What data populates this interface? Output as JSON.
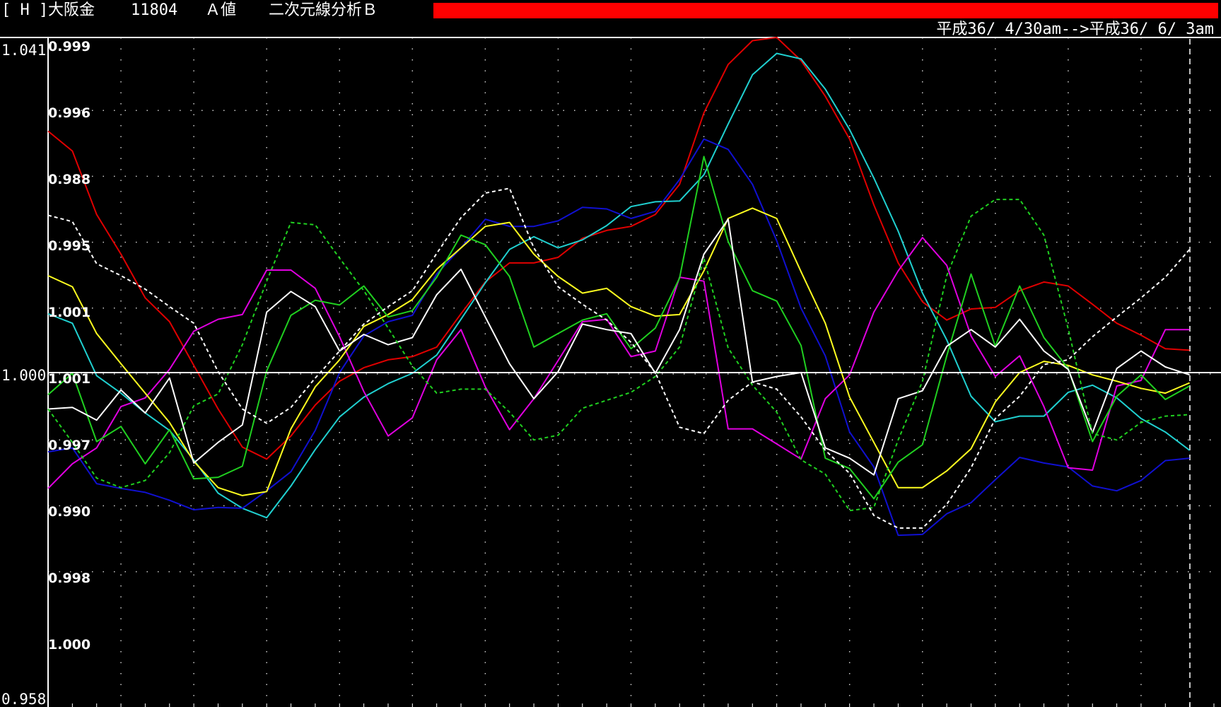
{
  "header": {
    "bracket": "[ H ]",
    "instrument": "大阪金",
    "code": "11804",
    "mode": "Ａ値",
    "analysis": "二次元線分析Ｂ",
    "date_range": "平成36/ 4/30am-->平成36/ 6/ 3am",
    "highlight_color": "#ff0000"
  },
  "chart_data": {
    "type": "line",
    "title": "",
    "background": "#000000",
    "grid": "dotted",
    "xlim": [
      0,
      48
    ],
    "ylim": [
      0.958,
      1.041
    ],
    "outer_axis_labels": [
      "1.041",
      "1.000",
      "0.958"
    ],
    "inner_labels": [
      "0.999",
      "0.996",
      "0.988",
      "0.995",
      "1.001",
      "1.001",
      "0.997",
      "0.990",
      "0.998",
      "1.000"
    ],
    "baseline": 1.0,
    "series": [
      {
        "color": "#e00000",
        "style": "solid",
        "values": [
          1.0292,
          1.0267,
          1.0187,
          1.0137,
          1.0082,
          1.0052,
          0.9997,
          0.9942,
          0.9894,
          0.9879,
          0.9908,
          0.9947,
          0.9977,
          0.9994,
          1.0004,
          1.0008,
          1.002,
          1.0062,
          1.0102,
          1.0126,
          1.0126,
          1.0133,
          1.0157,
          1.0167,
          1.0172,
          1.0187,
          1.0225,
          1.0315,
          1.0376,
          1.0406,
          1.041,
          1.0381,
          1.0336,
          1.0282,
          1.0199,
          1.0126,
          1.0077,
          1.0054,
          1.0068,
          1.007,
          1.0091,
          1.0102,
          1.0097,
          1.0074,
          1.005,
          1.0035,
          1.0018,
          1.0016
        ]
      },
      {
        "color": "#20d0d0",
        "style": "solid",
        "values": [
          1.0062,
          1.005,
          0.9984,
          0.9962,
          0.9937,
          0.9915,
          0.9878,
          0.9836,
          0.9817,
          0.9805,
          0.9845,
          0.9891,
          0.9932,
          0.9957,
          0.9974,
          0.9987,
          1.001,
          1.0055,
          1.0101,
          1.0143,
          1.0159,
          1.0145,
          1.0155,
          1.0173,
          1.0197,
          1.0203,
          1.0204,
          1.0237,
          1.0301,
          1.0363,
          1.039,
          1.0383,
          1.0345,
          1.0294,
          1.0233,
          1.0166,
          1.0088,
          1.0029,
          0.9958,
          0.9926,
          0.9933,
          0.9933,
          0.9963,
          0.9972,
          0.9956,
          0.993,
          0.9913,
          0.989
        ]
      },
      {
        "color": "#1010d0",
        "style": "solid",
        "values": [
          0.9888,
          0.9893,
          0.9848,
          0.9842,
          0.9837,
          0.9827,
          0.9815,
          0.9818,
          0.9817,
          0.9839,
          0.9863,
          0.9915,
          0.9988,
          1.0034,
          1.0052,
          1.006,
          1.0112,
          1.0145,
          1.0181,
          1.0172,
          1.0172,
          1.0179,
          1.0196,
          1.0194,
          1.0182,
          1.0191,
          1.0231,
          1.0282,
          1.0269,
          1.0225,
          1.0154,
          1.0069,
          1.0009,
          0.9913,
          0.9869,
          0.9783,
          0.9784,
          0.981,
          0.9824,
          0.9853,
          0.9881,
          0.9874,
          0.9869,
          0.9845,
          0.9839,
          0.9852,
          0.9877,
          0.988
        ]
      },
      {
        "color": "#e000e0",
        "style": "solid",
        "values": [
          0.9842,
          0.9873,
          0.9893,
          0.9945,
          0.9956,
          0.9992,
          1.004,
          1.0055,
          1.0061,
          1.0117,
          1.0117,
          1.0094,
          1.0033,
          0.9964,
          0.9908,
          0.9931,
          1.0004,
          1.0042,
          0.997,
          0.9916,
          0.9955,
          1.0003,
          1.0052,
          1.0055,
          1.0008,
          1.0015,
          1.0108,
          1.0103,
          0.9917,
          0.9917,
          0.9898,
          0.9879,
          0.9955,
          0.9985,
          1.0064,
          1.0116,
          1.0158,
          1.0123,
          1.0034,
          0.9983,
          1.0009,
          0.9945,
          0.9868,
          0.9865,
          0.9971,
          0.9978,
          1.0042,
          1.0042
        ]
      },
      {
        "color": "#ffff20",
        "style": "solid",
        "values": [
          1.011,
          1.0096,
          1.0037,
          0.9999,
          0.9962,
          0.9925,
          0.9876,
          0.9843,
          0.9833,
          0.9838,
          0.9917,
          0.997,
          1.0004,
          1.0046,
          1.0061,
          1.008,
          1.0118,
          1.0145,
          1.0172,
          1.0177,
          1.0137,
          1.0109,
          1.0088,
          1.0094,
          1.0071,
          1.0059,
          1.0061,
          1.0116,
          1.0182,
          1.0195,
          1.0182,
          1.0115,
          1.005,
          0.9957,
          0.99,
          0.9843,
          0.9843,
          0.9864,
          0.9892,
          0.9951,
          0.9988,
          1.0002,
          0.9997,
          0.9985,
          0.9977,
          0.9968,
          0.9962,
          0.9975
        ]
      },
      {
        "color": "#20d020",
        "style": "solid",
        "values": [
          0.996,
          0.9987,
          0.9901,
          0.992,
          0.9873,
          0.9916,
          0.9854,
          0.9856,
          0.987,
          0.999,
          1.006,
          1.0079,
          1.0073,
          1.0097,
          1.0058,
          1.0066,
          1.0108,
          1.0161,
          1.0149,
          1.0109,
          1.002,
          1.0037,
          1.0054,
          1.0062,
          1.0018,
          1.0044,
          1.0107,
          1.026,
          1.0153,
          1.0091,
          1.0078,
          1.0022,
          0.988,
          0.9867,
          0.9829,
          0.9875,
          0.9897,
          1.0009,
          1.0112,
          1.0021,
          1.0097,
          1.0032,
          0.9993,
          0.9901,
          0.9958,
          0.9985,
          0.9954,
          0.9971
        ]
      },
      {
        "color": "#ffffff",
        "style": "solid",
        "values": [
          0.9942,
          0.9944,
          0.9928,
          0.9966,
          0.9937,
          0.9981,
          0.9874,
          0.99,
          0.9922,
          1.0064,
          1.009,
          1.0071,
          1.0015,
          1.0036,
          1.0023,
          1.0032,
          1.0086,
          1.0118,
          1.0058,
          0.9999,
          0.9955,
          0.9989,
          1.0049,
          1.0042,
          1.0037,
          0.9987,
          1.0042,
          1.0137,
          1.0181,
          0.9976,
          0.9983,
          0.9988,
          0.9893,
          0.988,
          0.9859,
          0.9955,
          0.9965,
          1.0021,
          1.0042,
          1.002,
          1.0055,
          1.0015,
          0.9992,
          0.9912,
          0.9993,
          1.0015,
          0.9995,
          0.9985
        ]
      },
      {
        "color": "#20d020",
        "style": "dashed",
        "values": [
          0.9942,
          0.99,
          0.9855,
          0.9843,
          0.9852,
          0.9887,
          0.9946,
          0.9961,
          1.0023,
          1.0103,
          1.0177,
          1.0174,
          1.0132,
          1.0091,
          1.0044,
          0.9996,
          0.9962,
          0.9967,
          0.9967,
          0.9938,
          0.9903,
          0.9909,
          0.9943,
          0.9953,
          0.9963,
          0.9983,
          1.002,
          1.0132,
          1.0019,
          0.9972,
          0.9938,
          0.9878,
          0.986,
          0.9814,
          0.9818,
          0.9903,
          0.9977,
          1.011,
          1.0185,
          1.0206,
          1.0206,
          1.0161,
          1.0043,
          0.9911,
          0.9903,
          0.9925,
          0.9933,
          0.9935
        ]
      },
      {
        "color": "#ffffff",
        "style": "dashed",
        "values": [
          1.0186,
          1.0178,
          1.0125,
          1.011,
          1.0093,
          1.0071,
          1.005,
          0.9989,
          0.9942,
          0.9924,
          0.9944,
          0.9981,
          1.0015,
          1.0049,
          1.0071,
          1.0091,
          1.0138,
          1.0183,
          1.0214,
          1.022,
          1.0145,
          1.0096,
          1.0074,
          1.0054,
          1.0026,
          0.9988,
          0.9919,
          0.9911,
          0.9953,
          0.9976,
          0.9967,
          0.9932,
          0.989,
          0.9861,
          0.9808,
          0.9792,
          0.9792,
          0.9822,
          0.9868,
          0.993,
          0.9958,
          0.9998,
          1.0004,
          1.0033,
          1.0058,
          1.0082,
          1.0108,
          1.0143
        ]
      }
    ]
  }
}
